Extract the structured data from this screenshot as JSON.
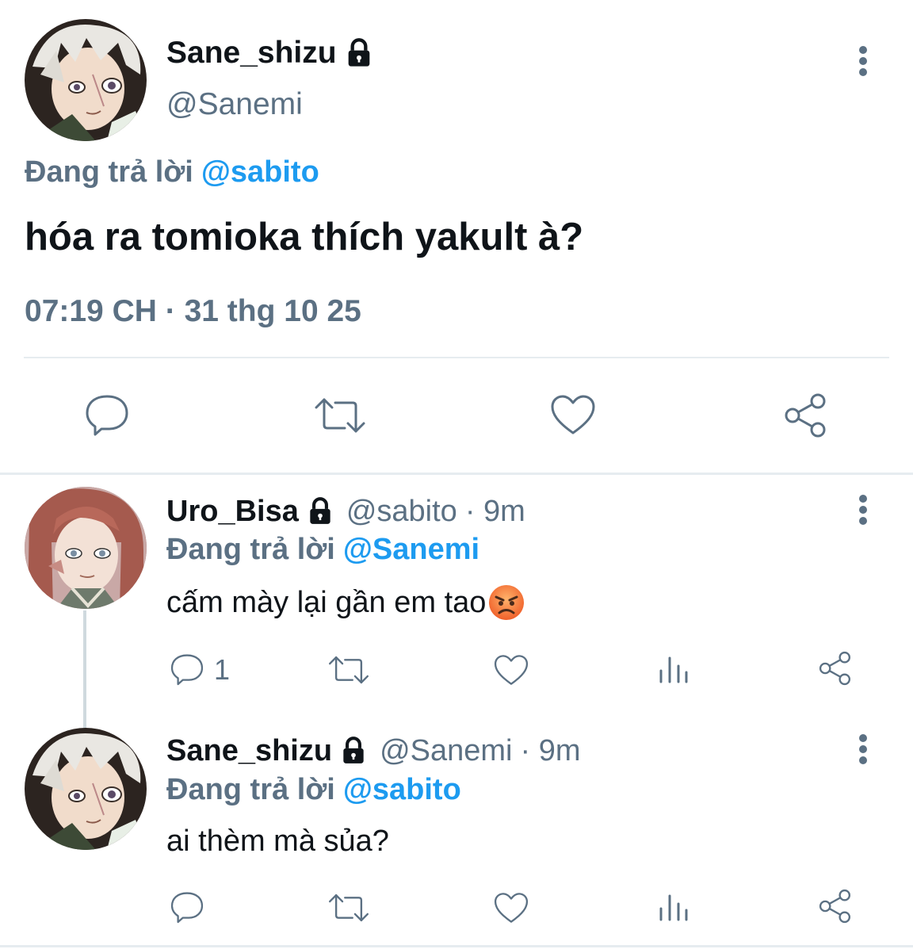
{
  "main_tweet": {
    "display_name": "Sane_shizu",
    "handle": "@Sanemi",
    "reply_prefix": "Đang trả lời",
    "reply_to": "@sabito",
    "text": "hóa ra tomioka thích yakult à?",
    "timestamp": "07:19 CH · 31 thg 10 25"
  },
  "replies": [
    {
      "display_name": "Uro_Bisa",
      "handle": "@sabito",
      "time": "· 9m",
      "reply_prefix": "Đang trả lời",
      "reply_to": "@Sanemi",
      "text": "cấm mày lại gần em tao",
      "reply_count": "1"
    },
    {
      "display_name": "Sane_shizu",
      "handle": "@Sanemi",
      "time": "· 9m",
      "reply_prefix": "Đang trả lời",
      "reply_to": "@sabito",
      "text": "ai thèm mà sủa?",
      "reply_count": ""
    }
  ],
  "icons": {
    "lock": "lock-icon",
    "more": "more-vertical-icon",
    "reply": "reply-icon",
    "retweet": "retweet-icon",
    "like": "heart-icon",
    "stats": "stats-icon",
    "share": "share-icon",
    "emoji": "angry-face-emoji"
  },
  "colors": {
    "text": "#0f1419",
    "secondary": "#5b7083",
    "link": "#1d9bf0",
    "divider": "#e6ecf0"
  }
}
